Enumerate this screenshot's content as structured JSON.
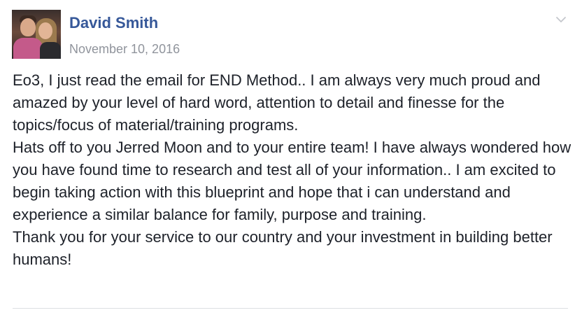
{
  "post": {
    "author": "David Smith",
    "date": "November 10, 2016",
    "paragraphs": [
      "Eo3, I just read the email for END Method.. I am always very much proud and amazed by your level of hard word, attention to detail and finesse for the topics/focus of material/training programs.",
      "Hats off to you Jerred Moon and to your entire team! I have always wondered how you have found time to research and test all of your information.. I am excited to begin taking action with this blueprint and hope that i can understand and experience a similar balance for family, purpose and training.",
      "Thank you for your service to our country and your investment in building better humans!"
    ],
    "menu_icon": "chevron-down-icon"
  },
  "colors": {
    "author_link": "#365899",
    "date_text": "#90949c",
    "body_text": "#1d2129",
    "divider": "#dddfe2"
  }
}
